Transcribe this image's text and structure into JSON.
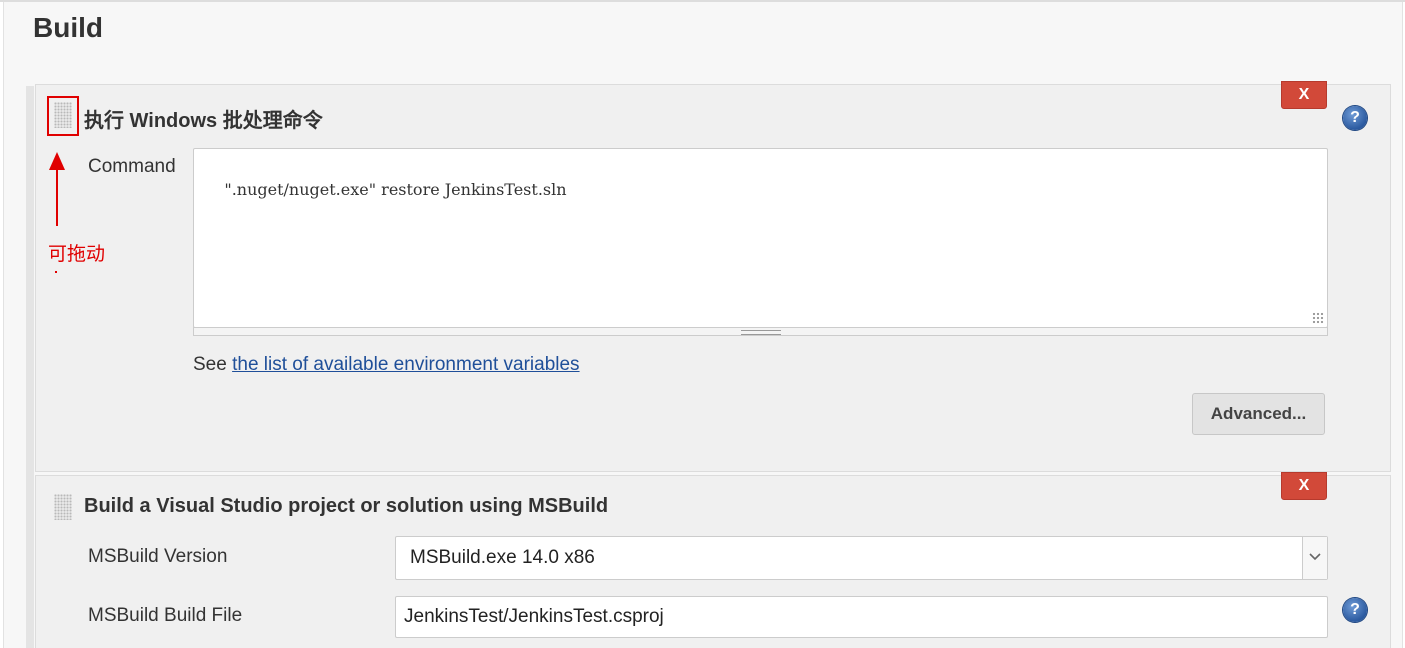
{
  "section": {
    "title": "Build"
  },
  "steps": [
    {
      "title": "执行 Windows 批处理命令",
      "delete_label": "X",
      "help_label": "?",
      "command_label": "Command",
      "command_value": "\".nuget/nuget.exe\" restore JenkinsTest.sln",
      "see_prefix": "See ",
      "see_link": "the list of available environment variables",
      "advanced_label": "Advanced..."
    },
    {
      "title": "Build a Visual Studio project or solution using MSBuild",
      "delete_label": "X",
      "help_label": "?",
      "version_label": "MSBuild Version",
      "version_value": "MSBuild.exe 14.0 x86",
      "buildfile_label": "MSBuild Build File",
      "buildfile_value": "JenkinsTest/JenkinsTest.csproj"
    }
  ],
  "annotation": {
    "text": "可拖动",
    "color": "#e00000"
  },
  "colors": {
    "delete": "#d24939",
    "link": "#1f4f99",
    "help": "#2b5aa0"
  }
}
